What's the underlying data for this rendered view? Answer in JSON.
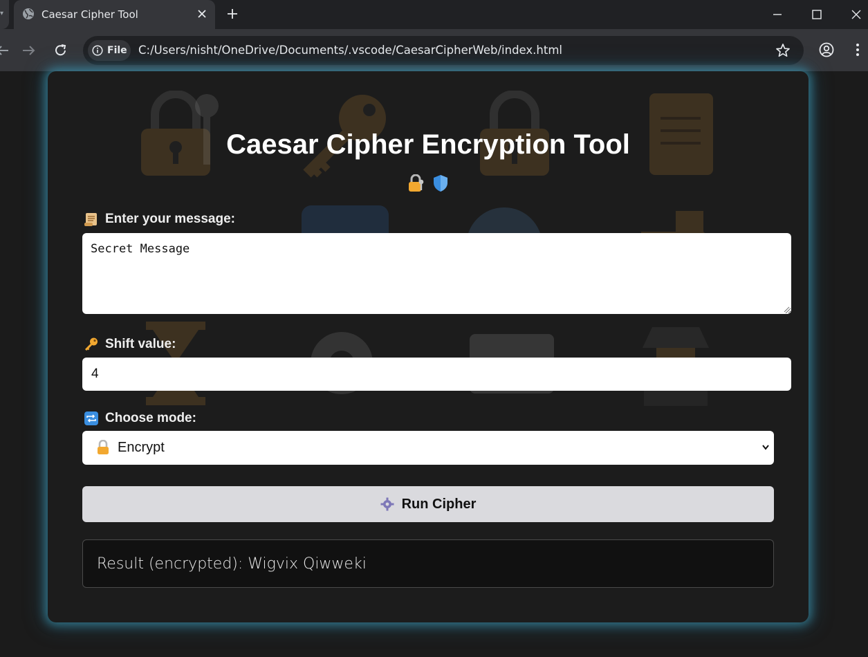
{
  "browser": {
    "tab_title": "Caesar Cipher Tool",
    "address_chip": "File",
    "url": "C:/Users/nisht/OneDrive/Documents/.vscode/CaesarCipherWeb/index.html"
  },
  "page": {
    "title": "Caesar Cipher Encryption Tool",
    "title_icons": [
      "lock-with-key-icon",
      "shield-icon"
    ],
    "message_label": "Enter your message:",
    "message_icon": "scroll-icon",
    "message_value": "Secret Message",
    "shift_label": "Shift value:",
    "shift_icon": "key-icon",
    "shift_value": "4",
    "mode_label": "Choose mode:",
    "mode_icon": "repeat-arrows-icon",
    "mode_selected": "Encrypt",
    "mode_selected_icon": "lock-icon",
    "run_label": "Run Cipher",
    "run_icon": "gear-icon",
    "result_text": "Result (encrypted): Wigvix Qiwweki"
  },
  "colors": {
    "card_glow": "#40aac8",
    "card_bg": "#1c1c1c",
    "button_bg": "#dadade",
    "result_bg": "#111111"
  }
}
